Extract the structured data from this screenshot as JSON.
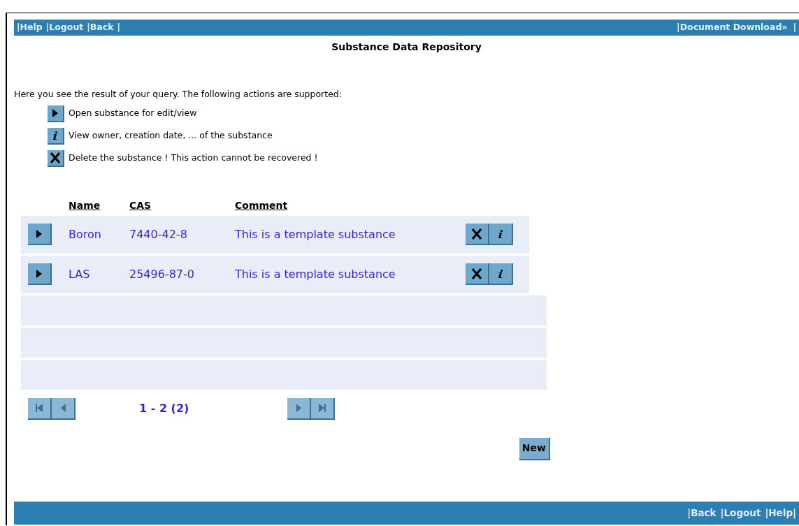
{
  "top_bar": {
    "left_links": [
      "|Help",
      "|Logout",
      "|Back",
      "|"
    ],
    "right_links": [
      "|Document Download»",
      "|"
    ]
  },
  "title": "Substance Data Repository",
  "intro": "Here you see the result of your query. The following actions are supported:",
  "legend": [
    {
      "kind": "open",
      "text": "Open substance for edit/view"
    },
    {
      "kind": "info",
      "text": "View owner, creation date, ... of the substance"
    },
    {
      "kind": "delete",
      "text": "Delete the substance ! This action cannot be recovered !"
    }
  ],
  "table": {
    "columns": [
      "Name",
      "CAS",
      "Comment"
    ],
    "rows": [
      {
        "name": "Boron",
        "cas": "7440-42-8",
        "comment": "This is a template substance"
      },
      {
        "name": "LAS",
        "cas": "25496-87-0",
        "comment": "This is a template substance"
      }
    ]
  },
  "pager": {
    "first_disabled": true,
    "prev_disabled": true,
    "range": "1 - 2 (2)",
    "next_disabled": true,
    "last_disabled": true
  },
  "new_button": "New",
  "bottom_bar": {
    "links": [
      "|Back",
      "|Logout",
      "|Help|"
    ]
  }
}
